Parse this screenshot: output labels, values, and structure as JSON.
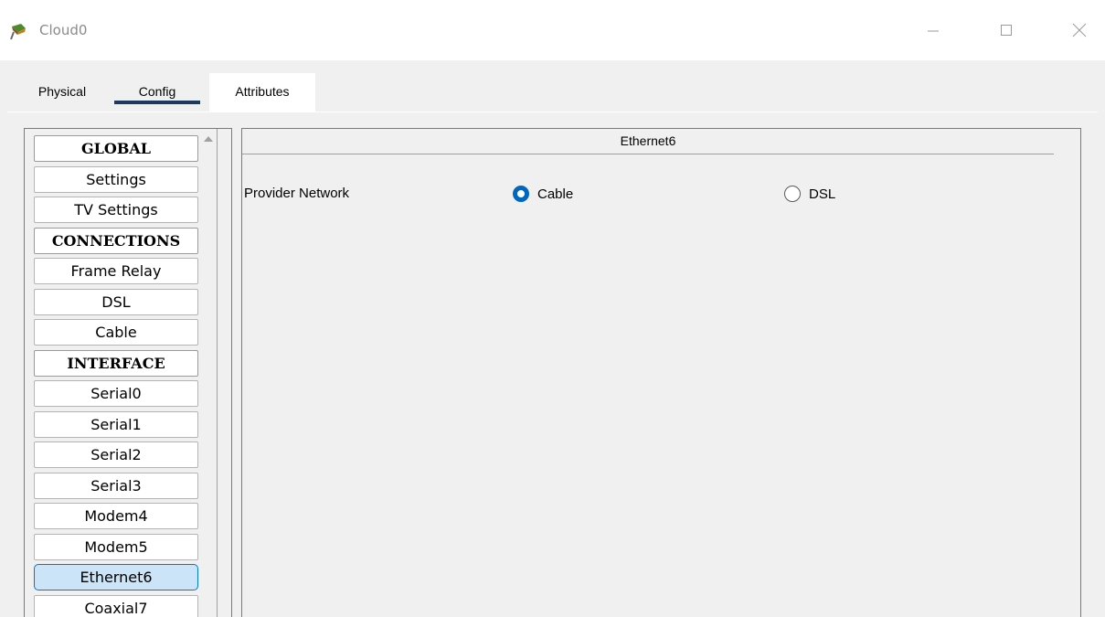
{
  "window": {
    "title": "Cloud0",
    "icon": "cloud-device-icon",
    "controls": [
      "minimize-icon",
      "maximize-icon",
      "close-icon"
    ]
  },
  "tabs": {
    "physical": "Physical",
    "config": "Config",
    "attributes": "Attributes",
    "active": "Config"
  },
  "sidebar": {
    "items": [
      {
        "label": "GLOBAL",
        "type": "header"
      },
      {
        "label": "Settings",
        "type": "item"
      },
      {
        "label": "TV Settings",
        "type": "item"
      },
      {
        "label": "CONNECTIONS",
        "type": "header"
      },
      {
        "label": "Frame Relay",
        "type": "item"
      },
      {
        "label": "DSL",
        "type": "item"
      },
      {
        "label": "Cable",
        "type": "item"
      },
      {
        "label": "INTERFACE",
        "type": "header"
      },
      {
        "label": "Serial0",
        "type": "item"
      },
      {
        "label": "Serial1",
        "type": "item"
      },
      {
        "label": "Serial2",
        "type": "item"
      },
      {
        "label": "Serial3",
        "type": "item"
      },
      {
        "label": "Modem4",
        "type": "item"
      },
      {
        "label": "Modem5",
        "type": "item"
      },
      {
        "label": "Ethernet6",
        "type": "item",
        "selected": true
      },
      {
        "label": "Coaxial7",
        "type": "item"
      }
    ]
  },
  "panel": {
    "title": "Ethernet6",
    "provider_label": "Provider Network",
    "options": [
      {
        "label": "Cable",
        "checked": true
      },
      {
        "label": "DSL",
        "checked": false
      }
    ]
  },
  "colors": {
    "accent": "#0067c0",
    "tab_underline": "#1a3b5f",
    "selected_bg": "#cce4f7",
    "selected_border": "#0078d7"
  }
}
